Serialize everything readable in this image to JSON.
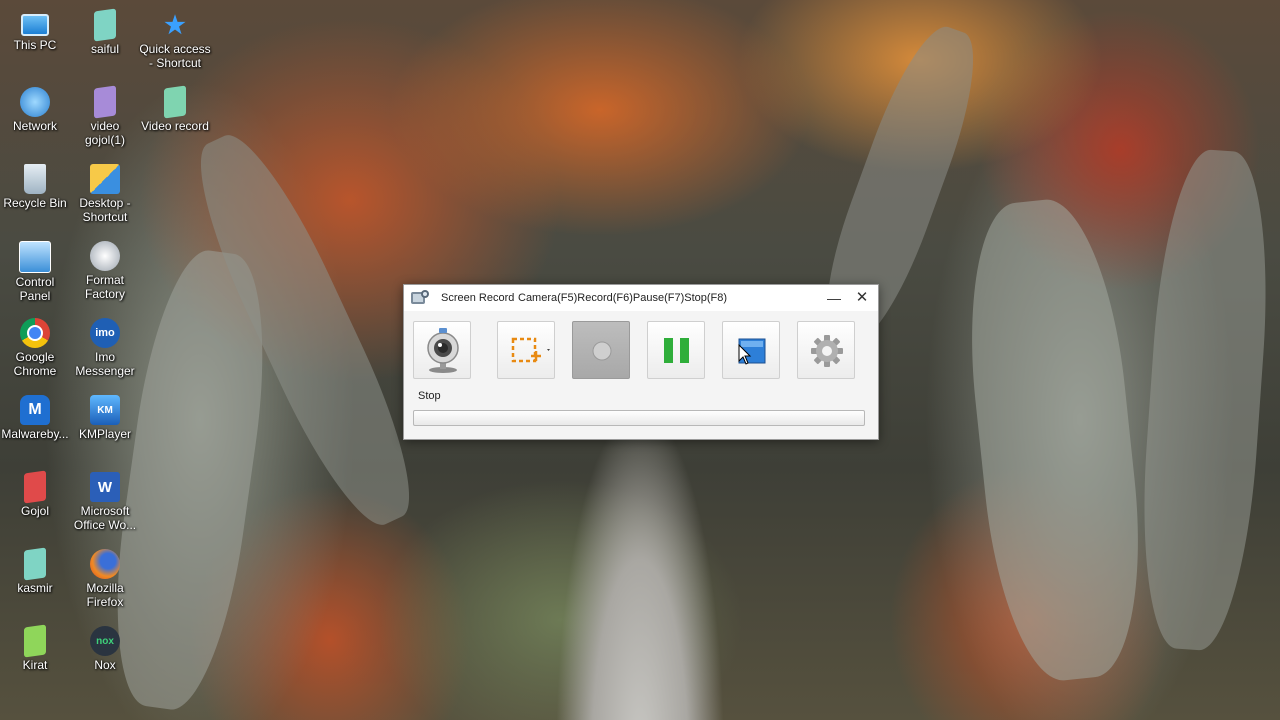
{
  "desktop": {
    "icons": [
      {
        "label": "This PC",
        "icon": "this-pc-icon"
      },
      {
        "label": "saiful",
        "icon": "folder-icon"
      },
      {
        "label": "Quick access\n- Shortcut",
        "icon": "star-shortcut-icon"
      },
      {
        "label": "Network",
        "icon": "network-icon"
      },
      {
        "label": "video\ngojol(1)",
        "icon": "folder-icon"
      },
      {
        "label": "Video record",
        "icon": "folder-icon"
      },
      {
        "label": "Recycle Bin",
        "icon": "recycle-bin-icon"
      },
      {
        "label": "Desktop -\nShortcut",
        "icon": "desktop-shortcut-icon"
      },
      {
        "label": "Control\nPanel",
        "icon": "control-panel-icon"
      },
      {
        "label": "Format\nFactory",
        "icon": "format-factory-icon"
      },
      {
        "label": "Google\nChrome",
        "icon": "chrome-icon"
      },
      {
        "label": "Imo\nMessenger",
        "icon": "imo-icon"
      },
      {
        "label": "Malwareby...",
        "icon": "malwarebytes-icon"
      },
      {
        "label": "KMPlayer",
        "icon": "kmplayer-icon"
      },
      {
        "label": "Gojol",
        "icon": "folder-icon"
      },
      {
        "label": "Microsoft\nOffice Wo...",
        "icon": "word-icon"
      },
      {
        "label": "kasmir",
        "icon": "folder-icon"
      },
      {
        "label": "Mozilla\nFirefox",
        "icon": "firefox-icon"
      },
      {
        "label": "Kirat",
        "icon": "folder-icon"
      },
      {
        "label": "Nox",
        "icon": "nox-icon"
      }
    ],
    "glyphs": {
      "imo": "imo",
      "nox": "nox"
    }
  },
  "window": {
    "title": "Screen Record",
    "shortcuts": "Camera(F5)Record(F6)Pause(F7)Stop(F8)",
    "minimize": "—",
    "close": "✕",
    "status": "Stop",
    "progress": 0,
    "toolbar": [
      {
        "name": "camera-button",
        "icon": "webcam-icon"
      },
      {
        "name": "select-region-button",
        "icon": "region-select-icon"
      },
      {
        "name": "record-button",
        "icon": "record-icon",
        "disabled": true
      },
      {
        "name": "pause-button",
        "icon": "pause-icon"
      },
      {
        "name": "stop-button",
        "icon": "stop-icon"
      },
      {
        "name": "settings-button",
        "icon": "gear-icon"
      }
    ]
  },
  "colors": {
    "folder": "#7fd4c4",
    "folder_purple": "#a78bd8",
    "folder_red": "#e04a4a",
    "folder_green": "#8fd65a",
    "pause": "#2fae3a",
    "stop": "#2d7fd8"
  }
}
